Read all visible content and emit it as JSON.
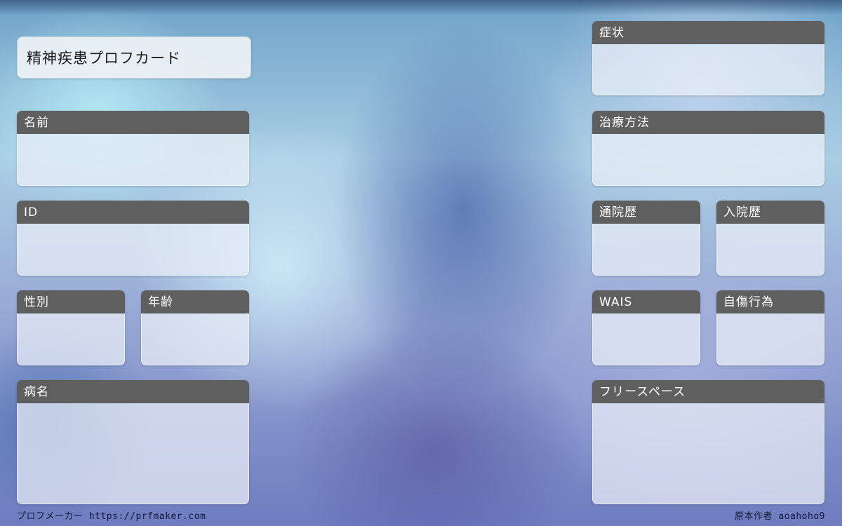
{
  "card": {
    "title": "精神疾患プロフカード"
  },
  "fields": {
    "name": "名前",
    "id": "ID",
    "gender": "性別",
    "age": "年齢",
    "disease": "病名",
    "symptoms": "症状",
    "treatment": "治療方法",
    "outpatient_history": "通院歴",
    "hospitalization_history": "入院歴",
    "wais": "WAIS",
    "self_harm": "自傷行為",
    "free_space": "フリースペース"
  },
  "footer": {
    "maker": "プロフメーカー https://prfmaker.com",
    "author": "原本作者 aoahoho9"
  }
}
